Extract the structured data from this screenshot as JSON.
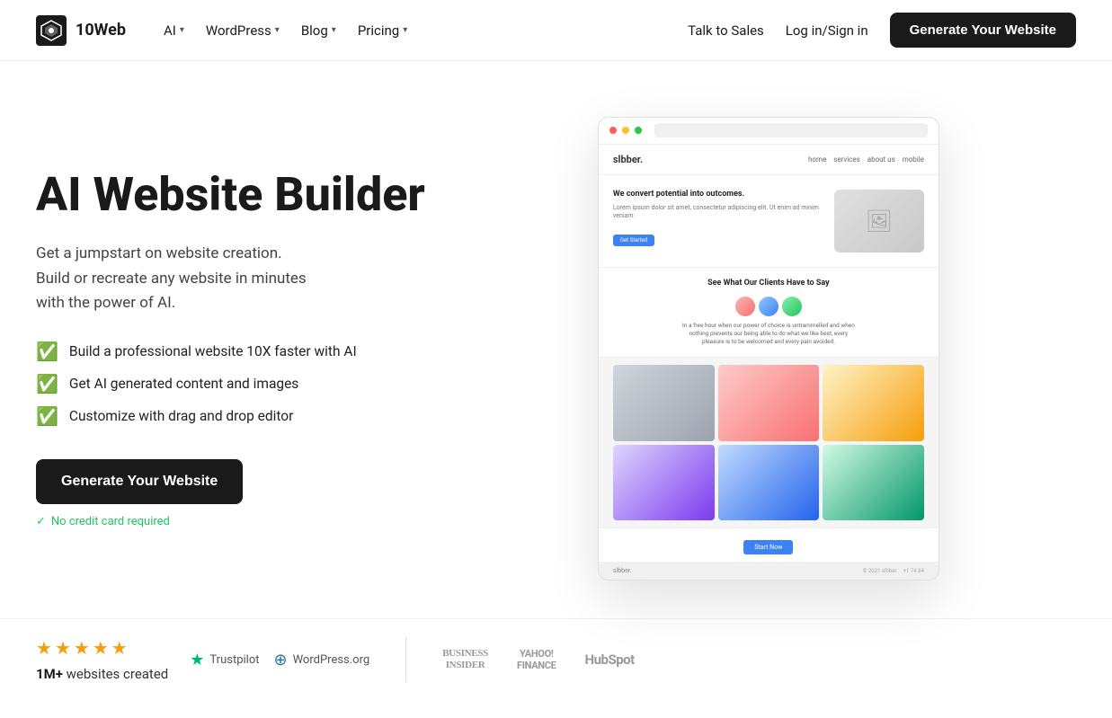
{
  "brand": {
    "name": "10Web",
    "logo_alt": "10Web Logo"
  },
  "nav": {
    "items": [
      {
        "label": "AI",
        "has_dropdown": true
      },
      {
        "label": "WordPress",
        "has_dropdown": true
      },
      {
        "label": "Blog",
        "has_dropdown": true
      },
      {
        "label": "Pricing",
        "has_dropdown": true
      }
    ],
    "right_links": [
      {
        "label": "Talk to Sales"
      },
      {
        "label": "Log in/Sign in"
      }
    ],
    "cta_button": "Generate Your Website"
  },
  "hero": {
    "title": "AI Website Builder",
    "subtitle_line1": "Get a jumpstart on website creation.",
    "subtitle_line2": "Build or recreate any website in minutes",
    "subtitle_line3": "with the power of AI.",
    "features": [
      "Build a professional website 10X faster with AI",
      "Get AI generated content and images",
      "Customize with drag and drop editor"
    ],
    "cta_button": "Generate Your Website",
    "no_cc_text": "No credit card required"
  },
  "mockup": {
    "site_name": "slbber.",
    "nav_links": [
      "home",
      "services",
      "about us",
      "mobile"
    ],
    "hero_heading": "We convert potential into outcomes.",
    "hero_body": "Lorem ipsum dolor sit amet, consectetur adipiscing elit. Ut enim ad minim veniam.",
    "hero_btn": "Get Started",
    "section_title": "See What Our Clients Have to Say",
    "quote": "In a free hour when our power of choice is untrammelled and when nothing prevents our being able to do what we like best, every pleasure is to be welcomed and every pain avoided.",
    "cta_btn": "Start Now"
  },
  "ratings": {
    "stars": 4.5,
    "count_prefix": "1M+",
    "count_suffix": "websites created"
  },
  "trust": {
    "trustpilot_label": "Trustpilot",
    "wordpress_label": "WordPress.org"
  },
  "partners": [
    {
      "name": "BUSINESS\nINSIDER",
      "style": "bi"
    },
    {
      "name": "YAHOO!\nFINANCE",
      "style": "yahoo"
    },
    {
      "name": "HubSpot",
      "style": "hs"
    }
  ]
}
